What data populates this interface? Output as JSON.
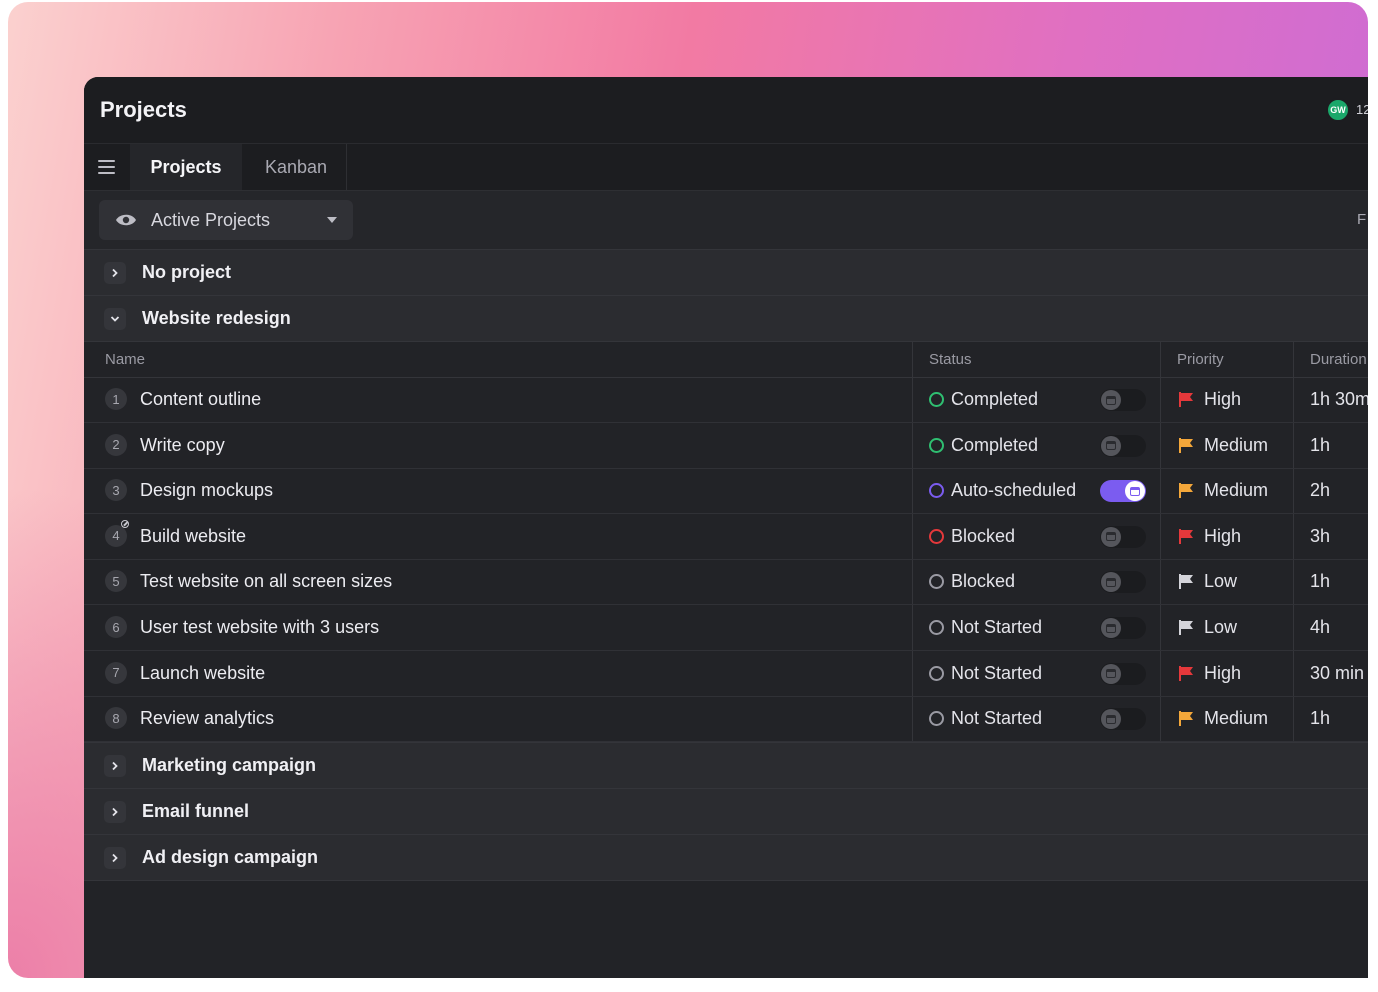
{
  "window": {
    "title": "Projects"
  },
  "avatar": {
    "initials": "GW",
    "count_partial": "12"
  },
  "tabs": [
    {
      "label": "Projects",
      "active": true
    },
    {
      "label": "Kanban",
      "active": false
    }
  ],
  "view_filter": {
    "label": "Active Projects",
    "right_partial": "F"
  },
  "groups_top": [
    {
      "label": "No project",
      "expanded": false
    },
    {
      "label": "Website redesign",
      "expanded": true
    }
  ],
  "table": {
    "headers": {
      "name": "Name",
      "status": "Status",
      "priority": "Priority",
      "duration": "Duration"
    },
    "rows": [
      {
        "num": "1",
        "name": "Content outline",
        "status": "Completed",
        "status_color": "#2fbf71",
        "auto": false,
        "priority": "High",
        "flag_color": "#e5383b",
        "duration": "1h 30m",
        "blocked_marker": false
      },
      {
        "num": "2",
        "name": "Write copy",
        "status": "Completed",
        "status_color": "#2fbf71",
        "auto": false,
        "priority": "Medium",
        "flag_color": "#f4a73a",
        "duration": "1h",
        "blocked_marker": false
      },
      {
        "num": "3",
        "name": "Design mockups",
        "status": "Auto-scheduled",
        "status_color": "#7b5cf0",
        "auto": true,
        "priority": "Medium",
        "flag_color": "#f4a73a",
        "duration": "2h",
        "blocked_marker": false
      },
      {
        "num": "4",
        "name": "Build website",
        "status": "Blocked",
        "status_color": "#e5383b",
        "auto": false,
        "priority": "High",
        "flag_color": "#e5383b",
        "duration": "3h",
        "blocked_marker": true
      },
      {
        "num": "5",
        "name": "Test website on all screen sizes",
        "status": "Blocked",
        "status_color": "#9a9aa3",
        "auto": false,
        "priority": "Low",
        "flag_color": "#d4d4da",
        "duration": "1h",
        "blocked_marker": false
      },
      {
        "num": "6",
        "name": "User test website with 3 users",
        "status": "Not Started",
        "status_color": "#9a9aa3",
        "auto": false,
        "priority": "Low",
        "flag_color": "#d4d4da",
        "duration": "4h",
        "blocked_marker": false
      },
      {
        "num": "7",
        "name": "Launch website",
        "status": "Not Started",
        "status_color": "#9a9aa3",
        "auto": false,
        "priority": "High",
        "flag_color": "#e5383b",
        "duration": "30 min",
        "blocked_marker": false
      },
      {
        "num": "8",
        "name": "Review analytics",
        "status": "Not Started",
        "status_color": "#9a9aa3",
        "auto": false,
        "priority": "Medium",
        "flag_color": "#f4a73a",
        "duration": "1h",
        "blocked_marker": false
      }
    ]
  },
  "groups_bottom": [
    {
      "label": "Marketing campaign",
      "expanded": false
    },
    {
      "label": "Email funnel",
      "expanded": false
    },
    {
      "label": "Ad design campaign",
      "expanded": false
    }
  ]
}
